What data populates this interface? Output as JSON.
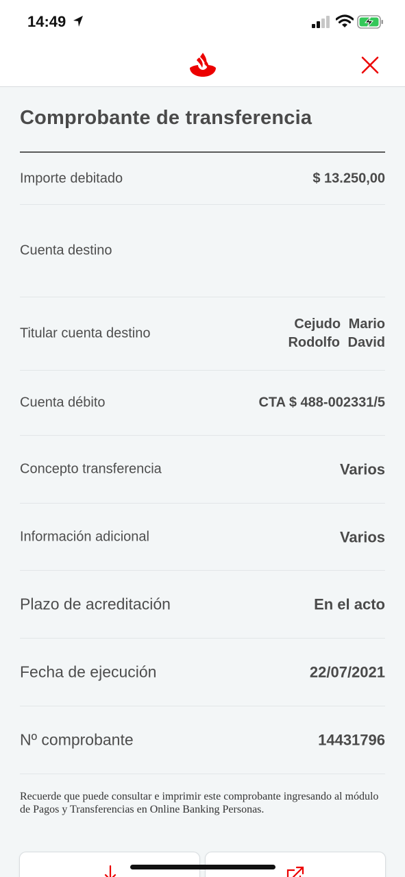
{
  "status_bar": {
    "time": "14:49",
    "icons": [
      "location-arrow-icon",
      "signal-bars-icon",
      "wifi-icon",
      "battery-charging-icon"
    ]
  },
  "header": {
    "logo": "santander-flame-logo",
    "close_icon": "close-icon"
  },
  "accent_color": "#ec0000",
  "title": "Comprobante de transferencia",
  "rows": [
    {
      "label": "Importe debitado",
      "value": "$ 13.250,00"
    },
    {
      "label": "Cuenta destino",
      "value": ""
    },
    {
      "label": "Titular cuenta destino",
      "value": "Cejudo Mario Rodolfo David"
    },
    {
      "label": "Cuenta débito",
      "value": "CTA $ 488-002331/5"
    },
    {
      "label": "Concepto transferencia",
      "value": "Varios"
    },
    {
      "label": "Información adicional",
      "value": "Varios"
    },
    {
      "label": "Plazo de acreditación",
      "value": "En el acto"
    },
    {
      "label": "Fecha de ejecución",
      "value": "22/07/2021"
    },
    {
      "label": "Nº comprobante",
      "value": "14431796"
    }
  ],
  "footnote": "Recuerde que puede consultar e imprimir este comprobante ingresando al módulo de Pagos y Transferencias en Online Banking Personas.",
  "actions": [
    {
      "icon": "download-icon"
    },
    {
      "icon": "share-icon"
    }
  ]
}
